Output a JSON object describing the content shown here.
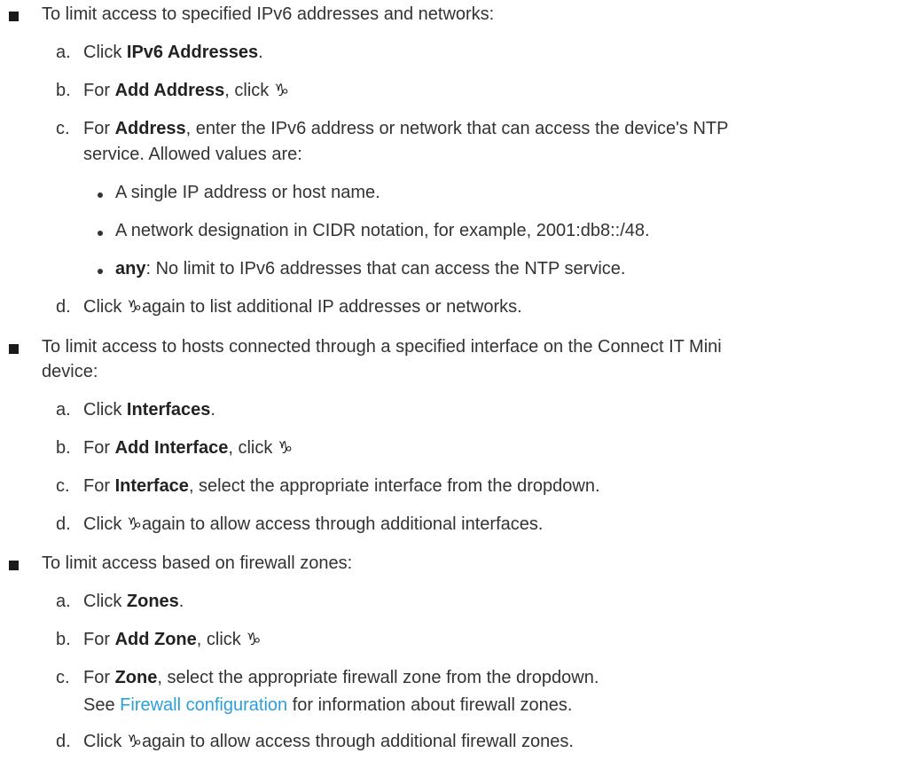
{
  "add_icon_glyph": "♑",
  "link_color": "#2a9fd8",
  "ipv6": {
    "intro": "To limit access to specified IPv6 addresses and networks:",
    "a": {
      "letter": "a.",
      "pre": "Click ",
      "bold": "IPv6 Addresses",
      "post": "."
    },
    "b": {
      "letter": "b.",
      "pre": "For ",
      "bold": "Add Address",
      "post": ", click "
    },
    "c": {
      "letter": "c.",
      "pre": "For ",
      "bold": "Address",
      "post": ", enter the IPv6 address or network that can access the device's NTP",
      "cont": "service. Allowed values are:"
    },
    "values": [
      {
        "bold": "",
        "text": "A single IP address or host name."
      },
      {
        "bold": "",
        "text": "A network designation in CIDR notation, for example, 2001:db8::/48."
      },
      {
        "bold": "any",
        "text": ": No limit to IPv6 addresses that can access the NTP service."
      }
    ],
    "d": {
      "letter": "d.",
      "pre": "Click ",
      "post": "again to list additional IP addresses or networks."
    }
  },
  "interfaces": {
    "intro": "To limit access to hosts connected through a specified interface on the Connect IT Mini",
    "intro_cont": "device:",
    "a": {
      "letter": "a.",
      "pre": "Click ",
      "bold": "Interfaces",
      "post": "."
    },
    "b": {
      "letter": "b.",
      "pre": "For ",
      "bold": "Add Interface",
      "post": ", click "
    },
    "c": {
      "letter": "c.",
      "pre": "For ",
      "bold": "Interface",
      "post": ", select the appropriate interface from the dropdown."
    },
    "d": {
      "letter": "d.",
      "pre": "Click ",
      "post": "again to allow access through additional interfaces."
    }
  },
  "zones": {
    "intro": "To limit access based on firewall zones:",
    "a": {
      "letter": "a.",
      "pre": "Click ",
      "bold": "Zones",
      "post": "."
    },
    "b": {
      "letter": "b.",
      "pre": "For ",
      "bold": "Add Zone",
      "post": ", click "
    },
    "c": {
      "letter": "c.",
      "pre": "For ",
      "bold": "Zone",
      "post": ", select the appropriate firewall zone from the dropdown."
    },
    "see": {
      "pre": "See ",
      "link": "Firewall configuration",
      "post": " for information about firewall zones."
    },
    "d": {
      "letter": "d.",
      "pre": "Click ",
      "post": "again to allow access through additional firewall zones."
    }
  }
}
